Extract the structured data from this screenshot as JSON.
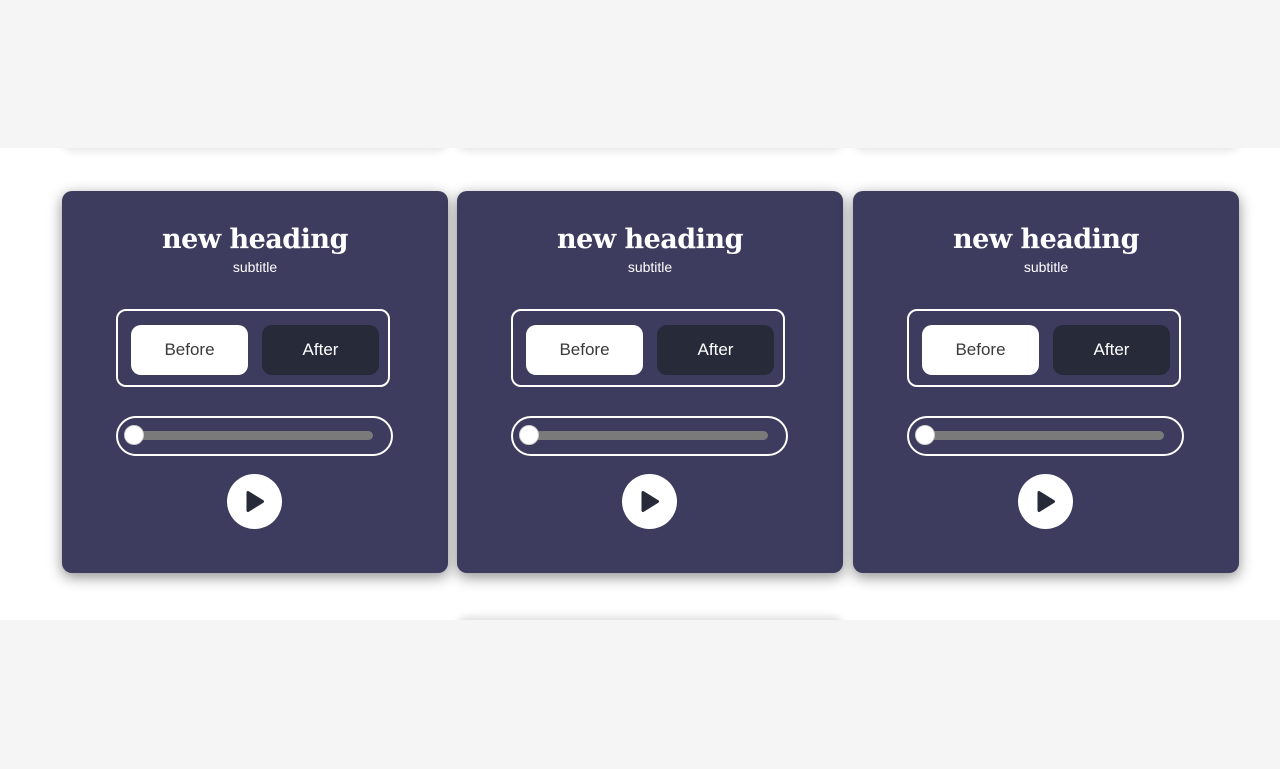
{
  "cards": [
    {
      "title": "new heading",
      "subtitle": "subtitle",
      "before_label": "Before",
      "after_label": "After",
      "progress": 0
    },
    {
      "title": "new heading",
      "subtitle": "subtitle",
      "before_label": "Before",
      "after_label": "After",
      "progress": 0
    },
    {
      "title": "new heading",
      "subtitle": "subtitle",
      "before_label": "Before",
      "after_label": "After",
      "progress": 0
    }
  ],
  "icons": {
    "play": "play-icon"
  },
  "colors": {
    "page_background": "#f5f5f5",
    "band_background": "#ffffff",
    "card_background": "#3d3b5e",
    "after_button": "#262a39",
    "slider_track": "#7a7a7a"
  }
}
